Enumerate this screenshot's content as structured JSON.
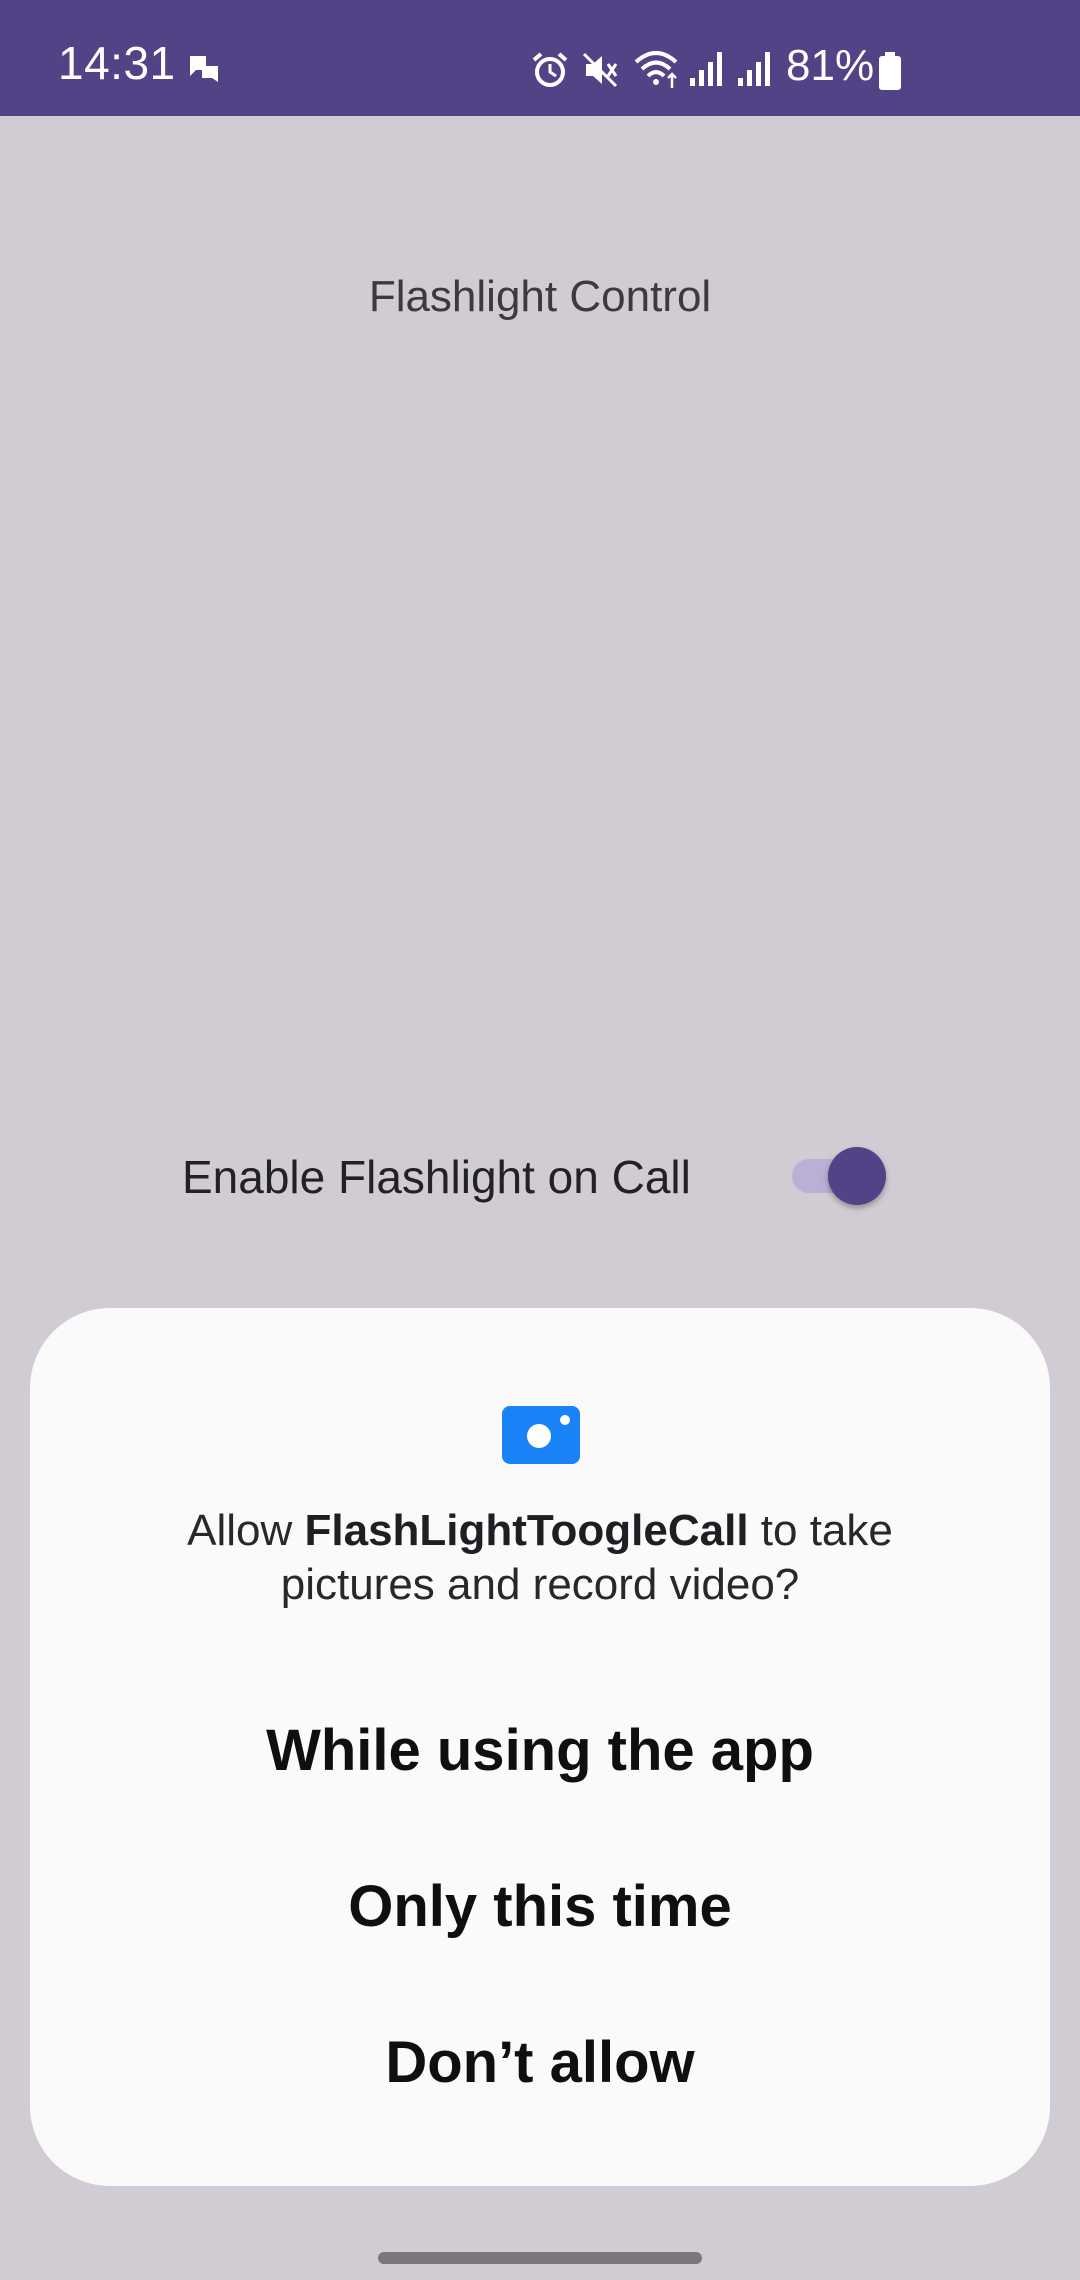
{
  "status_bar": {
    "time": "14:31",
    "battery_text": "81%",
    "icons": [
      "chat-notification-icon",
      "alarm-icon",
      "mute-icon",
      "wifi-icon",
      "signal-icon",
      "signal-icon",
      "battery-icon"
    ]
  },
  "screen": {
    "title": "Flashlight Control",
    "setting_label": "Enable Flashlight on Call",
    "toggle_on": true
  },
  "dialog": {
    "icon": "camera-icon",
    "message_prefix": "Allow ",
    "app_name": "FlashLightToogleCall",
    "message_suffix": " to take pictures and record video?",
    "buttons": [
      {
        "label": "While using the app"
      },
      {
        "label": "Only this time"
      },
      {
        "label": "Don’t allow"
      }
    ]
  },
  "colors": {
    "status_bar": "#514386",
    "background": "#d1ccd3",
    "accent": "#514386",
    "camera_icon": "#1a82f7",
    "dialog_bg": "#fafafa"
  }
}
